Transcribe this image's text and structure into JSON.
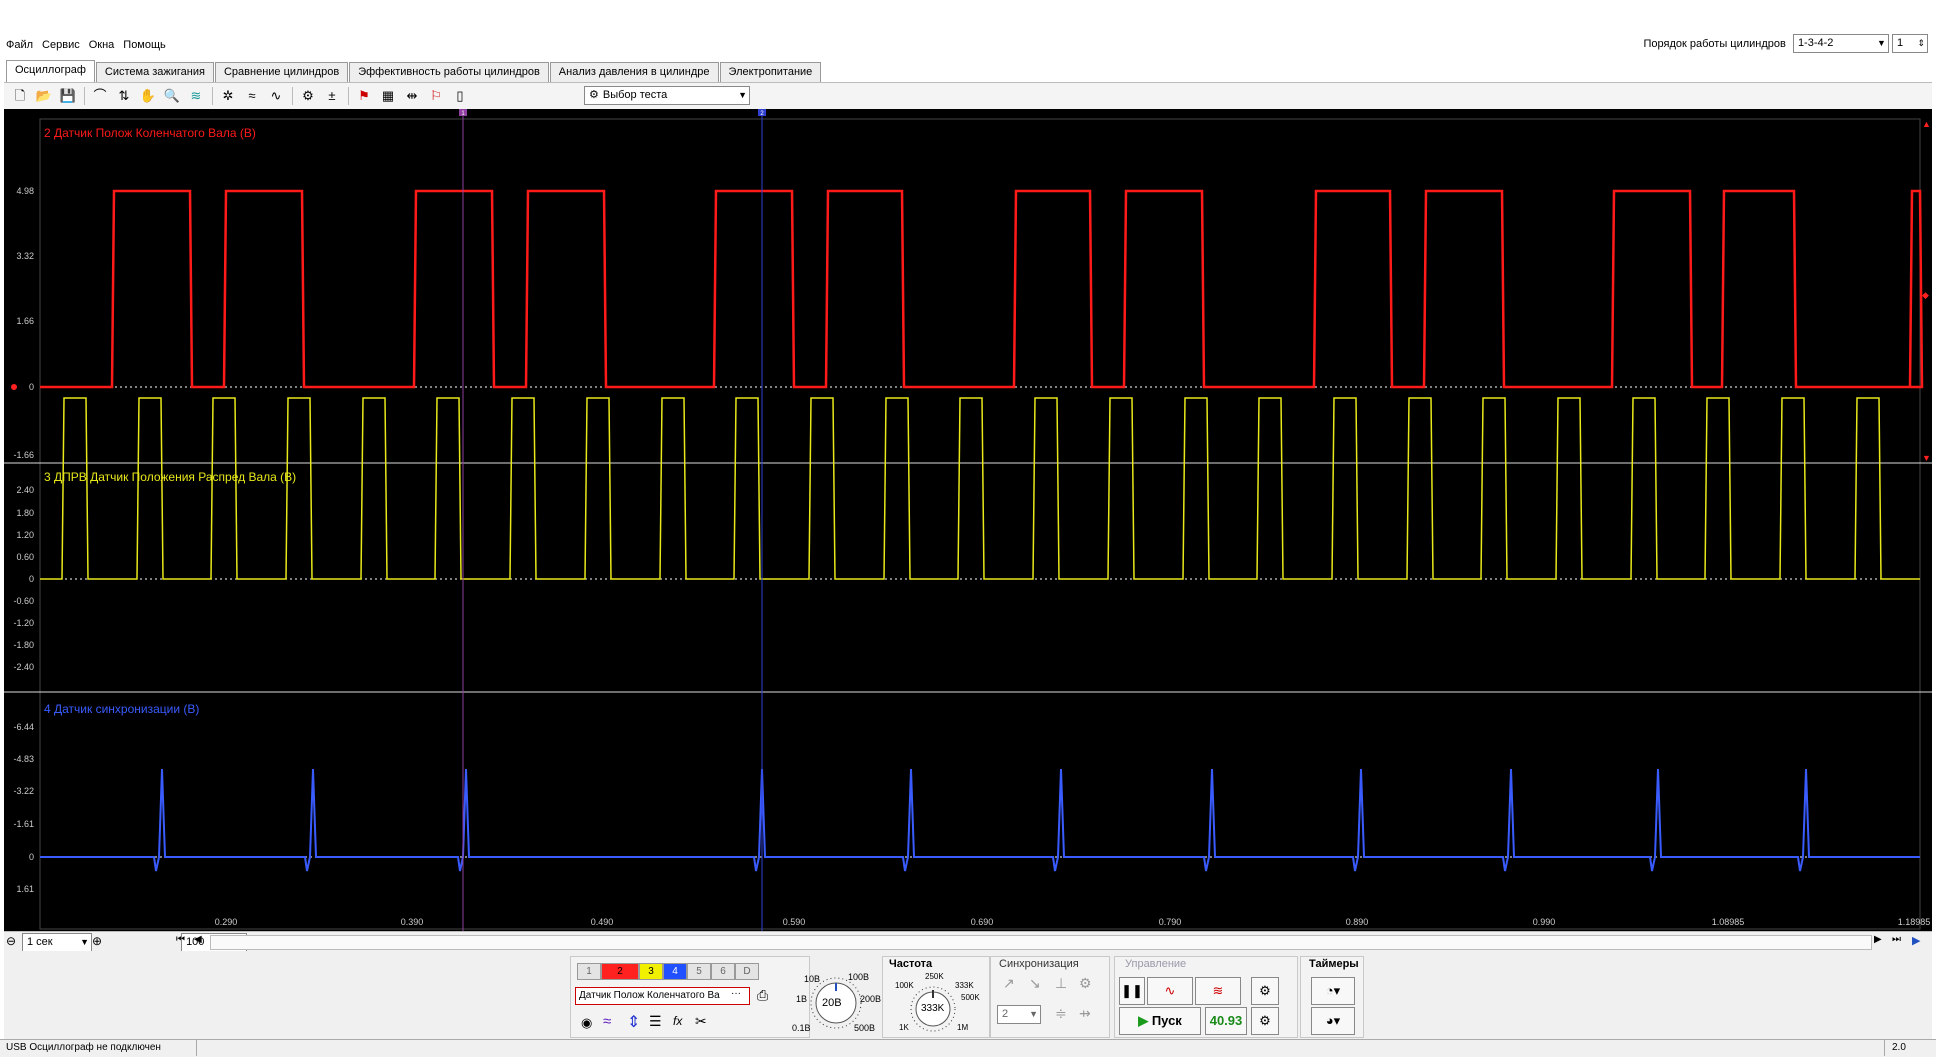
{
  "menu": [
    "Файл",
    "Сервис",
    "Окна",
    "Помощь"
  ],
  "cylinder_order": {
    "label": "Порядок работы цилиндров",
    "value": "1-3-4-2",
    "index": "1"
  },
  "tabs": [
    "Осциллограф",
    "Система зажигания",
    "Сравнение цилиндров",
    "Эффективность работы цилиндров",
    "Анализ давления в цилиндре",
    "Электропитание"
  ],
  "toolbar": {
    "test_select": "Выбор теста"
  },
  "channels": [
    {
      "name": "2 Датчик Полож Коленчатого Вала (В)",
      "color": "#ff1a1a",
      "y_ticks": [
        "4.98",
        "3.32",
        "1.66",
        "0",
        "-1.66"
      ]
    },
    {
      "name": "3 ДПРВ Датчик Положения Распред Вала (В)",
      "color": "#e8e81a",
      "y_ticks": [
        "2.40",
        "1.80",
        "1.20",
        "0.60",
        "0",
        "-0.60",
        "-1.20",
        "-1.80",
        "-2.40"
      ]
    },
    {
      "name": "4 Датчик синхронизации (В)",
      "color": "#3a5cff",
      "y_ticks": [
        "-6.44",
        "-4.83",
        "-3.22",
        "-1.61",
        "0",
        "1.61"
      ]
    }
  ],
  "x_ticks": [
    "0.290",
    "0.390",
    "0.490",
    "0.590",
    "0.690",
    "0.790",
    "0.890",
    "0.990",
    "1.08985",
    "1.18985"
  ],
  "cursors": [
    "1",
    "2"
  ],
  "nav": {
    "timebase": "1 сек",
    "zoom": "100"
  },
  "panel": {
    "channel_buttons": [
      "1",
      "2",
      "3",
      "4",
      "5",
      "6",
      "D"
    ],
    "channel_colors": {
      "2": "#ff2020",
      "3": "#f0f000",
      "4": "#2050ff"
    },
    "sensor_select": "Датчик Полож Коленчатого Ва",
    "voltage_knob": {
      "value": "20В",
      "labels": [
        "10В",
        "100В",
        "1В",
        "200В",
        "0.1В",
        "500В"
      ]
    },
    "freq_title": "Частота",
    "freq_knob": {
      "value": "333K",
      "labels": [
        "250K",
        "100K",
        "333K",
        "500K",
        "1K",
        "1M"
      ]
    },
    "sync_title": "Синхронизация",
    "sync_channel": "2",
    "control_title": "Управление",
    "start_label": "Пуск",
    "counter": "40.93",
    "timers_title": "Таймеры"
  },
  "status": {
    "left": "USB Осциллограф не подключен",
    "right": "2.0"
  }
}
